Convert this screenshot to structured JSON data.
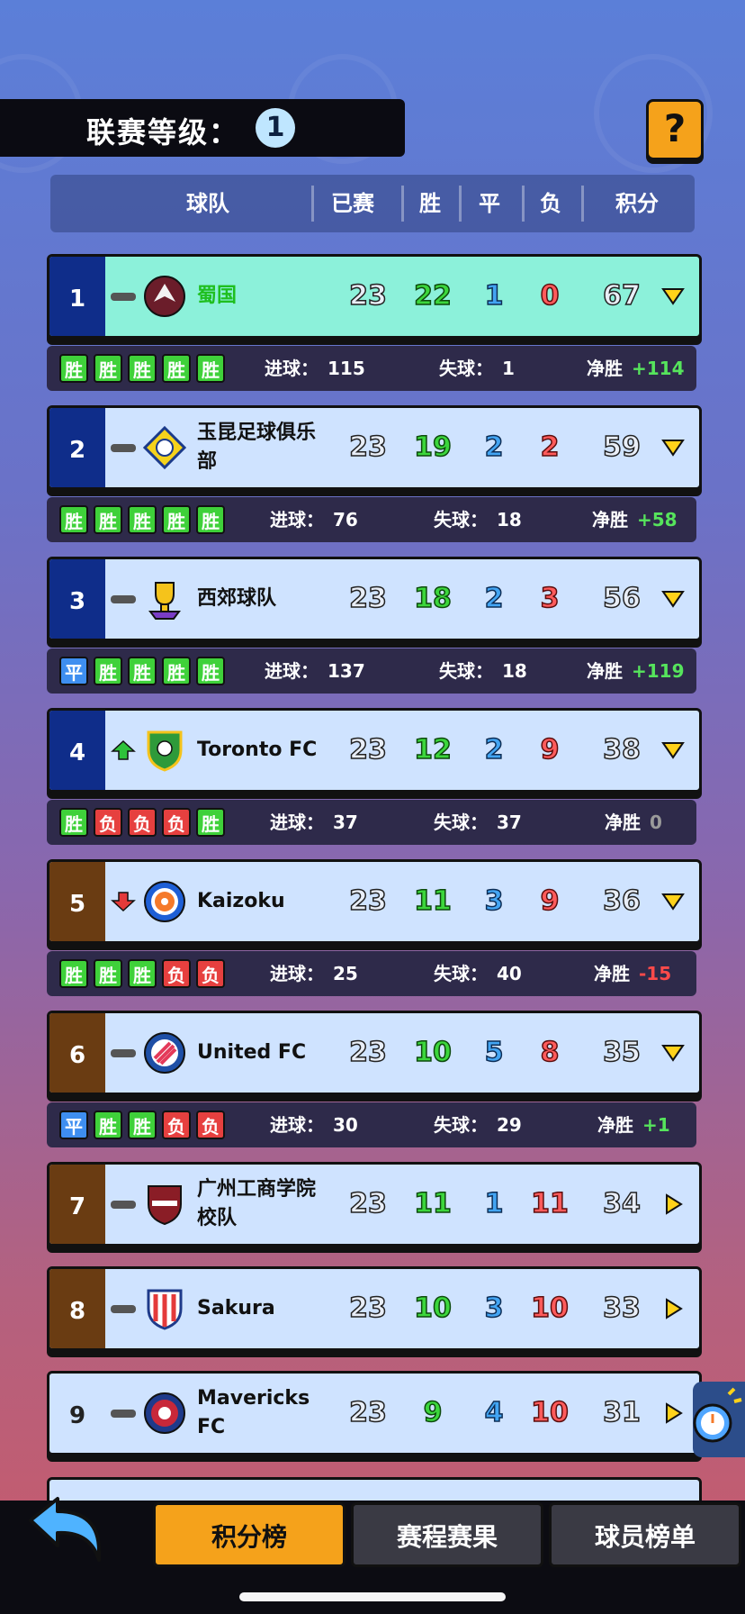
{
  "league": {
    "label": "联赛等级：",
    "level": "1"
  },
  "help_label": "?",
  "header": {
    "team": "球队",
    "played": "已赛",
    "win": "胜",
    "draw": "平",
    "loss": "负",
    "points": "积分"
  },
  "detail_labels": {
    "goals_for": "进球：",
    "goals_against": "失球：",
    "goal_diff": "净胜"
  },
  "rows": [
    {
      "rank": "1",
      "trend": "same",
      "name": "蜀国",
      "played": "23",
      "win": "22",
      "draw": "1",
      "loss": "0",
      "points": "67",
      "expanded": true,
      "form": [
        "胜",
        "胜",
        "胜",
        "胜",
        "胜"
      ],
      "goals_for": "115",
      "goals_against": "1",
      "goal_diff": "+114"
    },
    {
      "rank": "2",
      "trend": "same",
      "name": "玉昆足球俱乐部",
      "played": "23",
      "win": "19",
      "draw": "2",
      "loss": "2",
      "points": "59",
      "expanded": true,
      "form": [
        "胜",
        "胜",
        "胜",
        "胜",
        "胜"
      ],
      "goals_for": "76",
      "goals_against": "18",
      "goal_diff": "+58"
    },
    {
      "rank": "3",
      "trend": "same",
      "name": "西郊球队",
      "played": "23",
      "win": "18",
      "draw": "2",
      "loss": "3",
      "points": "56",
      "expanded": true,
      "form": [
        "平",
        "胜",
        "胜",
        "胜",
        "胜"
      ],
      "goals_for": "137",
      "goals_against": "18",
      "goal_diff": "+119"
    },
    {
      "rank": "4",
      "trend": "up",
      "name": "Toronto FC",
      "played": "23",
      "win": "12",
      "draw": "2",
      "loss": "9",
      "points": "38",
      "expanded": true,
      "form": [
        "胜",
        "负",
        "负",
        "负",
        "胜"
      ],
      "goals_for": "37",
      "goals_against": "37",
      "goal_diff": "0"
    },
    {
      "rank": "5",
      "trend": "down",
      "name": "Kaizoku",
      "played": "23",
      "win": "11",
      "draw": "3",
      "loss": "9",
      "points": "36",
      "expanded": true,
      "form": [
        "胜",
        "胜",
        "胜",
        "负",
        "负"
      ],
      "goals_for": "25",
      "goals_against": "40",
      "goal_diff": "-15"
    },
    {
      "rank": "6",
      "trend": "same",
      "name": "United FC",
      "played": "23",
      "win": "10",
      "draw": "5",
      "loss": "8",
      "points": "35",
      "expanded": true,
      "form": [
        "平",
        "胜",
        "胜",
        "负",
        "负"
      ],
      "goals_for": "30",
      "goals_against": "29",
      "goal_diff": "+1"
    },
    {
      "rank": "7",
      "trend": "same",
      "name": "广州工商学院校队",
      "played": "23",
      "win": "11",
      "draw": "1",
      "loss": "11",
      "points": "34",
      "expanded": false
    },
    {
      "rank": "8",
      "trend": "same",
      "name": "Sakura",
      "played": "23",
      "win": "10",
      "draw": "3",
      "loss": "10",
      "points": "33",
      "expanded": false
    },
    {
      "rank": "9",
      "trend": "same",
      "name": "Mavericks FC",
      "played": "23",
      "win": "9",
      "draw": "4",
      "loss": "10",
      "points": "31",
      "expanded": false
    }
  ],
  "tabs": {
    "standings": "积分榜",
    "schedule": "赛程赛果",
    "players": "球员榜单"
  },
  "colors": {
    "accent": "#f5a21b",
    "win": "#3fd13a",
    "loss": "#e6403f",
    "draw": "#3e8ef0"
  }
}
